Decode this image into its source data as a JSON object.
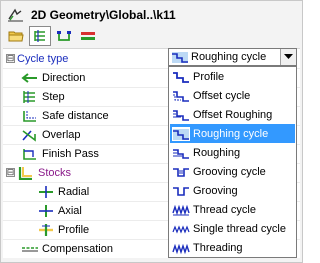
{
  "window": {
    "title": "2D Geometry\\Global..\\k11"
  },
  "toolbar": {
    "buttons": [
      {
        "icon": "folder-icon"
      },
      {
        "icon": "parameters-icon"
      },
      {
        "icon": "contour-icon"
      },
      {
        "icon": "tool-icon"
      }
    ]
  },
  "tree": {
    "cycle_type": {
      "label": "Cycle type",
      "expander": "⊟",
      "value": "Roughing cycle"
    },
    "items": [
      {
        "label": "Direction",
        "icon": "direction-icon"
      },
      {
        "label": "Step",
        "icon": "step-icon"
      },
      {
        "label": "Safe distance",
        "icon": "safe-distance-icon"
      },
      {
        "label": "Overlap",
        "icon": "overlap-icon"
      },
      {
        "label": "Finish Pass",
        "icon": "finish-pass-icon"
      },
      {
        "label": "Stocks",
        "icon": "stocks-icon",
        "expander": "⊟"
      },
      {
        "label": "Radial",
        "icon": "radial-icon"
      },
      {
        "label": "Axial",
        "icon": "axial-icon"
      },
      {
        "label": "Profile",
        "icon": "profile-icon"
      },
      {
        "label": "Compensation",
        "icon": "compensation-icon"
      }
    ]
  },
  "dropdown": {
    "options": [
      "Profile",
      "Offset cycle",
      "Offset Roughing",
      "Roughing cycle",
      "Roughing",
      "Grooving cycle",
      "Grooving",
      "Thread cycle",
      "Single thread cycle",
      "Threading"
    ],
    "selected_index": 3
  },
  "colors": {
    "accent_blue": "#1a2dbd",
    "selection": "#3399ff",
    "stocks_purple": "#8a1a8a",
    "icon_green": "#2a9a2a"
  }
}
